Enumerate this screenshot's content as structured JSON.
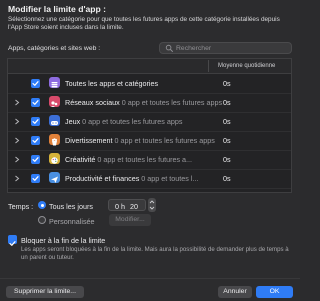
{
  "dialog": {
    "title": "Modifier la limite d'app :",
    "description": "Sélectionnez une catégorie pour que toutes les futures apps de cette catégorie installées depuis l'App Store soient incluses dans la limite."
  },
  "apps_section": {
    "label": "Apps, catégories et sites web :",
    "search_placeholder": "Rechercher",
    "column_header": "Moyenne quotidienne"
  },
  "rows": [
    {
      "name": "Toutes les apps et catégories",
      "sub": "",
      "value": "0s",
      "icon": "stack-icon",
      "color": "#8e6ce0",
      "expandable": false
    },
    {
      "name": "Réseaux sociaux",
      "sub": " 0 app et toutes les futures apps",
      "value": "0s",
      "icon": "social-icon",
      "color": "#d84a6b",
      "expandable": true
    },
    {
      "name": "Jeux",
      "sub": " 0 app et toutes les futures apps",
      "value": "0s",
      "icon": "game-icon",
      "color": "#3c6fd8",
      "expandable": true
    },
    {
      "name": "Divertissement",
      "sub": " 0 app et toutes les futures apps",
      "value": "0s",
      "icon": "popcorn-icon",
      "color": "#e0813a",
      "expandable": true
    },
    {
      "name": "Créativité",
      "sub": " 0 app et toutes les futures a...",
      "value": "0s",
      "icon": "palette-icon",
      "color": "#d6b23a",
      "expandable": true
    },
    {
      "name": "Productivité et finances",
      "sub": " 0 app et toutes l...",
      "value": "0s",
      "icon": "send-icon",
      "color": "#4a90e2",
      "expandable": true
    }
  ],
  "time": {
    "label": "Temps :",
    "option_every_day": "Tous les jours",
    "option_custom": "Personnalisée",
    "hours": "0 h",
    "minutes": "20 m",
    "modify_button": "Modifier..."
  },
  "block": {
    "label": "Bloquer à la fin de la limite",
    "description": "Les apps seront bloquées à la fin de la limite. Mais aura la possibilité de demander plus de temps à un parent ou tuteur."
  },
  "buttons": {
    "delete": "Supprimer la limite...",
    "cancel": "Annuler",
    "ok": "OK"
  },
  "colors": {
    "accent": "#2f7cf6"
  }
}
